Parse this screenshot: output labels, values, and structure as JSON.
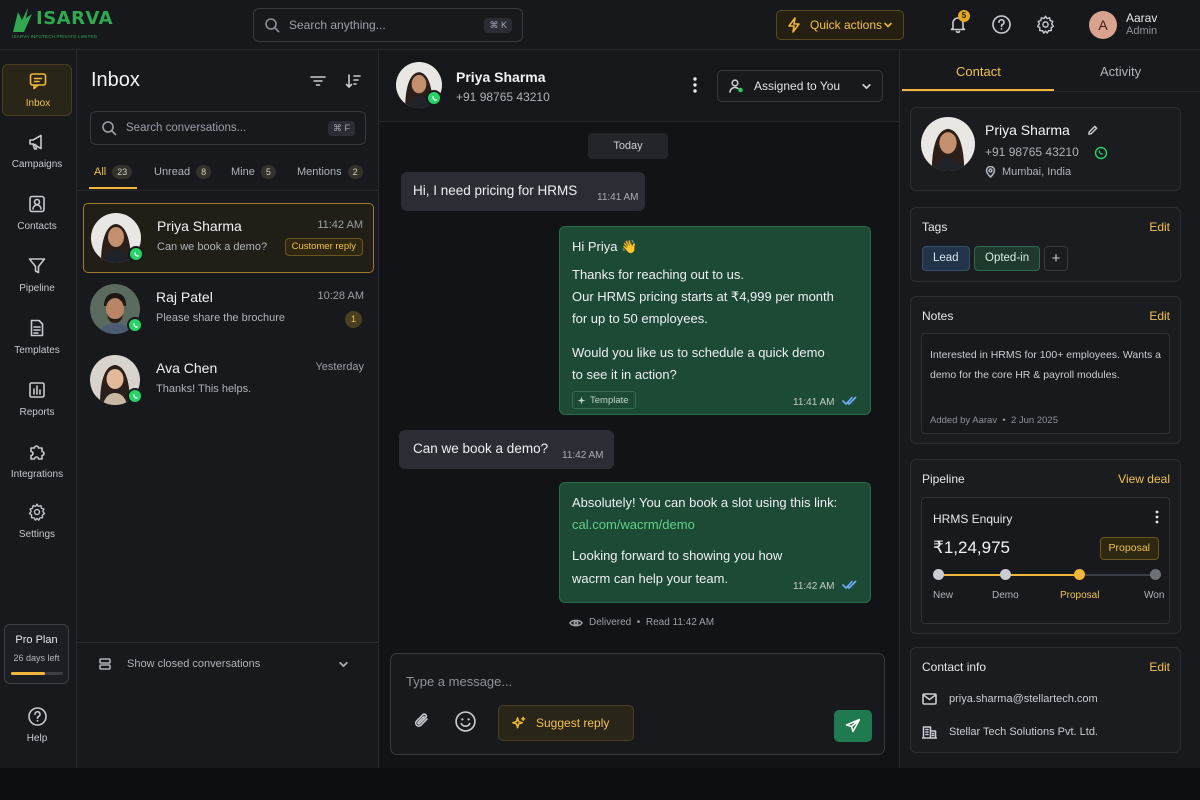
{
  "app": {
    "logo_name": "ISARVA",
    "logo_tagline": "ISARVA INFOTECH PRIVATE LIMITED",
    "accent_color": "#f0b73a",
    "whatsapp_color": "#25d366"
  },
  "topbar": {
    "search_placeholder": "Search anything...",
    "search_shortcut": "⌘ K",
    "quick_actions_label": "Quick actions",
    "notification_count": "5",
    "user_initial": "A",
    "user_name": "Aarav",
    "user_role": "Admin"
  },
  "leftnav": {
    "items": [
      {
        "label": "Inbox",
        "icon": "chat-bubble-icon",
        "active": true
      },
      {
        "label": "Campaigns",
        "icon": "megaphone-icon"
      },
      {
        "label": "Contacts",
        "icon": "contact-card-icon"
      },
      {
        "label": "Pipeline",
        "icon": "funnel-icon"
      },
      {
        "label": "Templates",
        "icon": "document-icon"
      },
      {
        "label": "Reports",
        "icon": "bar-chart-icon"
      },
      {
        "label": "Integrations",
        "icon": "puzzle-icon"
      },
      {
        "label": "Settings",
        "icon": "gear-icon"
      }
    ],
    "plan": {
      "name": "Pro Plan",
      "days_left": "26 days left",
      "progress": 0.65
    },
    "help_label": "Help"
  },
  "inbox": {
    "title": "Inbox",
    "search_placeholder": "Search conversations...",
    "search_shortcut": "⌘ F",
    "tabs": [
      {
        "label": "All",
        "count": "23",
        "active": true
      },
      {
        "label": "Unread",
        "count": "8"
      },
      {
        "label": "Mine",
        "count": "5"
      },
      {
        "label": "Mentions",
        "count": "2"
      }
    ],
    "conversations": [
      {
        "name": "Priya Sharma",
        "time": "11:42 AM",
        "snippet": "Can we book a demo?",
        "badge": "Customer reply",
        "active": true
      },
      {
        "name": "Raj Patel",
        "time": "10:28 AM",
        "snippet": "Please share the brochure",
        "unread": "1"
      },
      {
        "name": "Ava Chen",
        "time": "Yesterday",
        "snippet": "Thanks! This helps."
      }
    ],
    "show_closed_label": "Show closed conversations"
  },
  "chat": {
    "contact_name": "Priya Sharma",
    "contact_phone": "+91 98765 43210",
    "assigned_label": "Assigned to You",
    "date_label": "Today",
    "messages": [
      {
        "dir": "in",
        "text": "Hi, I need pricing for HRMS",
        "time": "11:41 AM"
      },
      {
        "dir": "out",
        "lines": [
          "Hi Priya 👋",
          "Thanks for reaching out to us.",
          "Our HRMS pricing starts at ₹4,999 per month",
          "for up to 50 employees.",
          "Would you like us to schedule a quick demo",
          "to see it in action?"
        ],
        "tag": "Template",
        "time": "11:41 AM"
      },
      {
        "dir": "in",
        "text": "Can we book a demo?",
        "time": "11:42 AM"
      },
      {
        "dir": "out",
        "lines": [
          "Absolutely! You can book a slot using this link:",
          "cal.com/wacrm/demo",
          "Looking forward to showing you how",
          "wacrm can help your team."
        ],
        "time": "11:42 AM"
      }
    ],
    "delivery_status": "Delivered  •  Read 11:42 AM",
    "composer_placeholder": "Type a message...",
    "suggest_label": "Suggest reply"
  },
  "right": {
    "tabs": [
      {
        "label": "Contact",
        "active": true
      },
      {
        "label": "Activity"
      }
    ],
    "contact": {
      "name": "Priya Sharma",
      "phone": "+91 98765 43210",
      "location": "Mumbai, India"
    },
    "tags": {
      "title": "Tags",
      "action": "Edit",
      "items": [
        "Lead",
        "Opted-in"
      ]
    },
    "notes": {
      "title": "Notes",
      "action": "Edit",
      "text": "Interested in HRMS for 100+ employees. Wants a demo for the core HR & payroll modules.",
      "meta": "Added by Aarav  •  2 Jun 2025"
    },
    "pipeline": {
      "title": "Pipeline",
      "action": "View deal",
      "deal_name": "HRMS Enquiry",
      "amount": "₹1,24,975",
      "stage": "Proposal",
      "stages": [
        "New",
        "Demo",
        "Proposal",
        "Won"
      ],
      "current_stage_index": 2
    },
    "contact_info": {
      "title": "Contact info",
      "action": "Edit",
      "email": "priya.sharma@stellartech.com",
      "company": "Stellar Tech Solutions Pvt. Ltd."
    }
  }
}
